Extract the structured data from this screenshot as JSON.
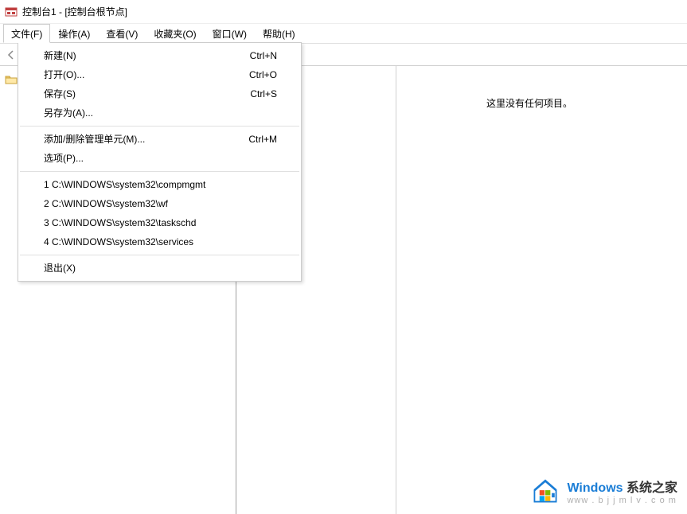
{
  "window": {
    "title": "控制台1 - [控制台根节点]"
  },
  "menubar": {
    "file": "文件(F)",
    "action": "操作(A)",
    "view": "查看(V)",
    "favorites": "收藏夹(O)",
    "window": "窗口(W)",
    "help": "帮助(H)"
  },
  "file_menu": {
    "new": {
      "label": "新建(N)",
      "shortcut": "Ctrl+N"
    },
    "open": {
      "label": "打开(O)...",
      "shortcut": "Ctrl+O"
    },
    "save": {
      "label": "保存(S)",
      "shortcut": "Ctrl+S"
    },
    "saveas": {
      "label": "另存为(A)...",
      "shortcut": ""
    },
    "snapin": {
      "label": "添加/删除管理单元(M)...",
      "shortcut": "Ctrl+M"
    },
    "options": {
      "label": "选项(P)...",
      "shortcut": ""
    },
    "recent1": "1 C:\\WINDOWS\\system32\\compmgmt",
    "recent2": "2 C:\\WINDOWS\\system32\\wf",
    "recent3": "3 C:\\WINDOWS\\system32\\taskschd",
    "recent4": "4 C:\\WINDOWS\\system32\\services",
    "exit": "退出(X)"
  },
  "detail": {
    "empty": "这里没有任何项目。"
  },
  "watermark": {
    "brand_en": "Windows",
    "brand_zh": " 系统之家",
    "url": "www . b j j m l v . c o m"
  }
}
